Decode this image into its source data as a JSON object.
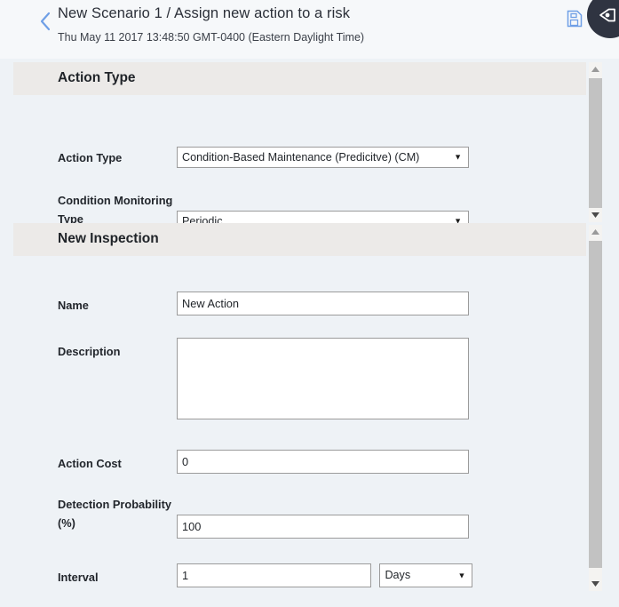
{
  "header": {
    "back_icon": "chevron-left-icon",
    "title": "New Scenario 1 / Assign new action to a risk",
    "subtitle": "Thu May 11 2017 13:48:50 GMT-0400 (Eastern Daylight Time)",
    "save_icon": "save-document-icon",
    "fab_icon": "tag-pen-icon",
    "accent_blue": "#6f9fe6",
    "fab_background": "#2f3441",
    "background": "#f6f8fa"
  },
  "theme": {
    "page_background": "#eef2f6",
    "section_bar_background": "#eceae8",
    "field_border": "#9b9b9b",
    "field_background": "#ffffff",
    "label_color": "#22262c",
    "scrollbar_track": "#f4f3f1",
    "scrollbar_thumb": "#c2c2c2"
  },
  "sections": [
    {
      "id": "action-type",
      "title": "Action Type",
      "fields": [
        {
          "name": "action-type",
          "label": "Action Type",
          "control": "select",
          "value": "Condition-Based Maintenance (Predicitve) (CM)",
          "arrow": "▼"
        },
        {
          "name": "condition-monitoring-type",
          "label": "Condition Monitoring Type",
          "control": "select",
          "value": "Periodic",
          "arrow": "▼"
        }
      ]
    },
    {
      "id": "new-inspection",
      "title": "New Inspection",
      "fields": [
        {
          "name": "name",
          "label": "Name",
          "control": "input",
          "value": "New Action"
        },
        {
          "name": "description",
          "label": "Description",
          "control": "textarea",
          "value": ""
        },
        {
          "name": "action-cost",
          "label": "Action Cost",
          "control": "input",
          "value": "0"
        },
        {
          "name": "detection-probability",
          "label": "Detection Probability (%)",
          "control": "input",
          "value": "100"
        },
        {
          "name": "interval",
          "label": "Interval",
          "control": "input-plus-select",
          "value": "1",
          "unit_value": "Days",
          "arrow": "▼"
        }
      ]
    }
  ]
}
